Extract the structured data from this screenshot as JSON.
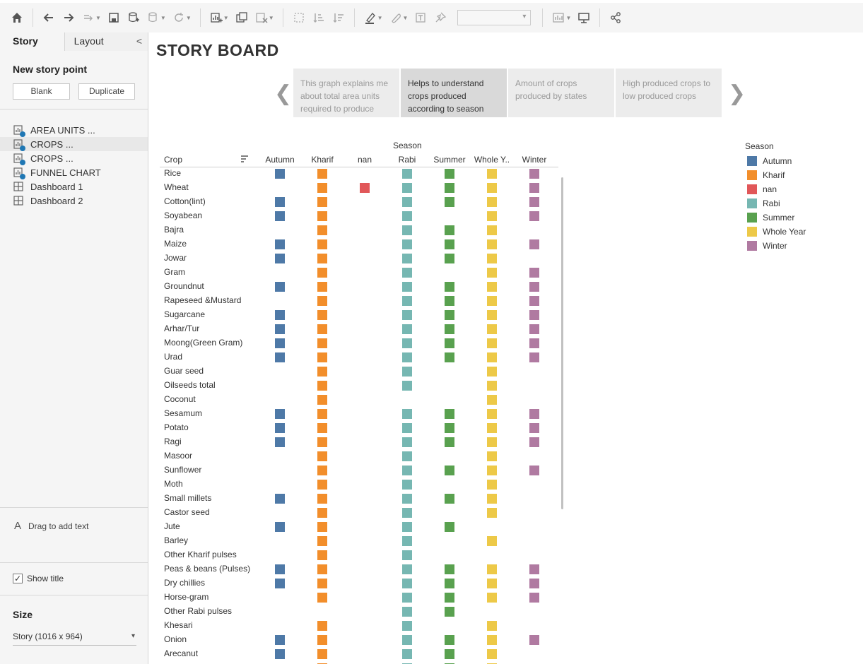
{
  "toolbar": {
    "icons": [
      "home-icon",
      "undo-icon",
      "redo-icon",
      "replay-icon",
      "save-icon",
      "new-datasource-icon",
      "pause-datasource-icon",
      "refresh-icon",
      "new-worksheet-icon",
      "duplicate-sheet-icon",
      "clear-sheet-icon",
      "swap-icon",
      "sort-ascending-icon",
      "sort-descending-icon",
      "highlight-icon",
      "group-icon",
      "label-icon",
      "pin-icon",
      "show-me-icon",
      "presentation-icon",
      "share-icon"
    ],
    "fit_select_value": ""
  },
  "leftpanel": {
    "tab_story": "Story",
    "tab_layout": "Layout",
    "collapse": "<",
    "new_story_point": "New story point",
    "blank_button": "Blank",
    "duplicate_button": "Duplicate",
    "sheets": [
      {
        "label": "AREA UNITS ...",
        "type": "worksheet"
      },
      {
        "label": "CROPS ...",
        "type": "worksheet"
      },
      {
        "label": "CROPS ...",
        "type": "worksheet"
      },
      {
        "label": "FUNNEL CHART",
        "type": "worksheet"
      },
      {
        "label": "Dashboard 1",
        "type": "dashboard"
      },
      {
        "label": "Dashboard 2",
        "type": "dashboard"
      }
    ],
    "drag_text": "Drag to add text",
    "drag_text_icon": "A",
    "show_title": "Show title",
    "show_title_checked": "✓",
    "size_label": "Size",
    "size_value": "Story (1016 x 964)"
  },
  "story": {
    "title": "STORY BOARD",
    "prev_arrow": "❮",
    "next_arrow": "❯",
    "points": [
      "This graph explains me about total area units required to produce",
      "Helps to understand crops produced according to season",
      "Amount of crops produced by states",
      "High produced crops to low produced crops"
    ],
    "active_point": 1
  },
  "chart_data": {
    "type": "table",
    "season_header": "Season",
    "crop_header": "Crop",
    "columns": [
      "Autumn",
      "Kharif",
      "nan",
      "Rabi",
      "Summer",
      "Whole Y..",
      "Winter"
    ],
    "colors": {
      "Autumn": "#4e79a7",
      "Kharif": "#f28e2b",
      "nan": "#e15759",
      "Rabi": "#76b7b2",
      "Summer": "#59a14f",
      "Whole Year": "#edc948",
      "Winter": "#b07aa1"
    },
    "rows": [
      {
        "crop": "Rice",
        "seasons": [
          1,
          1,
          0,
          1,
          1,
          1,
          1
        ]
      },
      {
        "crop": "Wheat",
        "seasons": [
          0,
          1,
          1,
          1,
          1,
          1,
          1
        ]
      },
      {
        "crop": "Cotton(lint)",
        "seasons": [
          1,
          1,
          0,
          1,
          1,
          1,
          1
        ]
      },
      {
        "crop": "Soyabean",
        "seasons": [
          1,
          1,
          0,
          1,
          0,
          1,
          1
        ]
      },
      {
        "crop": "Bajra",
        "seasons": [
          0,
          1,
          0,
          1,
          1,
          1,
          0
        ]
      },
      {
        "crop": "Maize",
        "seasons": [
          1,
          1,
          0,
          1,
          1,
          1,
          1
        ]
      },
      {
        "crop": "Jowar",
        "seasons": [
          1,
          1,
          0,
          1,
          1,
          1,
          0
        ]
      },
      {
        "crop": "Gram",
        "seasons": [
          0,
          1,
          0,
          1,
          0,
          1,
          1
        ]
      },
      {
        "crop": "Groundnut",
        "seasons": [
          1,
          1,
          0,
          1,
          1,
          1,
          1
        ]
      },
      {
        "crop": "Rapeseed &Mustard",
        "seasons": [
          0,
          1,
          0,
          1,
          1,
          1,
          1
        ]
      },
      {
        "crop": "Sugarcane",
        "seasons": [
          1,
          1,
          0,
          1,
          1,
          1,
          1
        ]
      },
      {
        "crop": "Arhar/Tur",
        "seasons": [
          1,
          1,
          0,
          1,
          1,
          1,
          1
        ]
      },
      {
        "crop": "Moong(Green Gram)",
        "seasons": [
          1,
          1,
          0,
          1,
          1,
          1,
          1
        ]
      },
      {
        "crop": "Urad",
        "seasons": [
          1,
          1,
          0,
          1,
          1,
          1,
          1
        ]
      },
      {
        "crop": "Guar seed",
        "seasons": [
          0,
          1,
          0,
          1,
          0,
          1,
          0
        ]
      },
      {
        "crop": "Oilseeds total",
        "seasons": [
          0,
          1,
          0,
          1,
          0,
          1,
          0
        ]
      },
      {
        "crop": "Coconut",
        "seasons": [
          0,
          1,
          0,
          0,
          0,
          1,
          0
        ]
      },
      {
        "crop": "Sesamum",
        "seasons": [
          1,
          1,
          0,
          1,
          1,
          1,
          1
        ]
      },
      {
        "crop": "Potato",
        "seasons": [
          1,
          1,
          0,
          1,
          1,
          1,
          1
        ]
      },
      {
        "crop": "Ragi",
        "seasons": [
          1,
          1,
          0,
          1,
          1,
          1,
          1
        ]
      },
      {
        "crop": "Masoor",
        "seasons": [
          0,
          1,
          0,
          1,
          0,
          1,
          0
        ]
      },
      {
        "crop": "Sunflower",
        "seasons": [
          0,
          1,
          0,
          1,
          1,
          1,
          1
        ]
      },
      {
        "crop": "Moth",
        "seasons": [
          0,
          1,
          0,
          1,
          0,
          1,
          0
        ]
      },
      {
        "crop": "Small millets",
        "seasons": [
          1,
          1,
          0,
          1,
          1,
          1,
          0
        ]
      },
      {
        "crop": "Castor seed",
        "seasons": [
          0,
          1,
          0,
          1,
          0,
          1,
          0
        ]
      },
      {
        "crop": "Jute",
        "seasons": [
          1,
          1,
          0,
          1,
          1,
          0,
          0
        ]
      },
      {
        "crop": "Barley",
        "seasons": [
          0,
          1,
          0,
          1,
          0,
          1,
          0
        ]
      },
      {
        "crop": "Other Kharif pulses",
        "seasons": [
          0,
          1,
          0,
          1,
          0,
          0,
          0
        ]
      },
      {
        "crop": "Peas & beans (Pulses)",
        "seasons": [
          1,
          1,
          0,
          1,
          1,
          1,
          1
        ]
      },
      {
        "crop": "Dry chillies",
        "seasons": [
          1,
          1,
          0,
          1,
          1,
          1,
          1
        ]
      },
      {
        "crop": "Horse-gram",
        "seasons": [
          0,
          1,
          0,
          1,
          1,
          1,
          1
        ]
      },
      {
        "crop": "Other Rabi pulses",
        "seasons": [
          0,
          0,
          0,
          1,
          1,
          0,
          0
        ]
      },
      {
        "crop": "Khesari",
        "seasons": [
          0,
          1,
          0,
          1,
          0,
          1,
          0
        ]
      },
      {
        "crop": "Onion",
        "seasons": [
          1,
          1,
          0,
          1,
          1,
          1,
          1
        ]
      },
      {
        "crop": "Arecanut",
        "seasons": [
          1,
          1,
          0,
          1,
          1,
          1,
          0
        ]
      },
      {
        "crop": "",
        "seasons": [
          0,
          1,
          0,
          1,
          1,
          1,
          0
        ]
      }
    ]
  },
  "legend": {
    "title": "Season",
    "items": [
      {
        "label": "Autumn",
        "color": "#4e79a7"
      },
      {
        "label": "Kharif",
        "color": "#f28e2b"
      },
      {
        "label": "nan",
        "color": "#e15759"
      },
      {
        "label": "Rabi",
        "color": "#76b7b2"
      },
      {
        "label": "Summer",
        "color": "#59a14f"
      },
      {
        "label": "Whole Year",
        "color": "#edc948"
      },
      {
        "label": "Winter",
        "color": "#b07aa1"
      }
    ]
  }
}
